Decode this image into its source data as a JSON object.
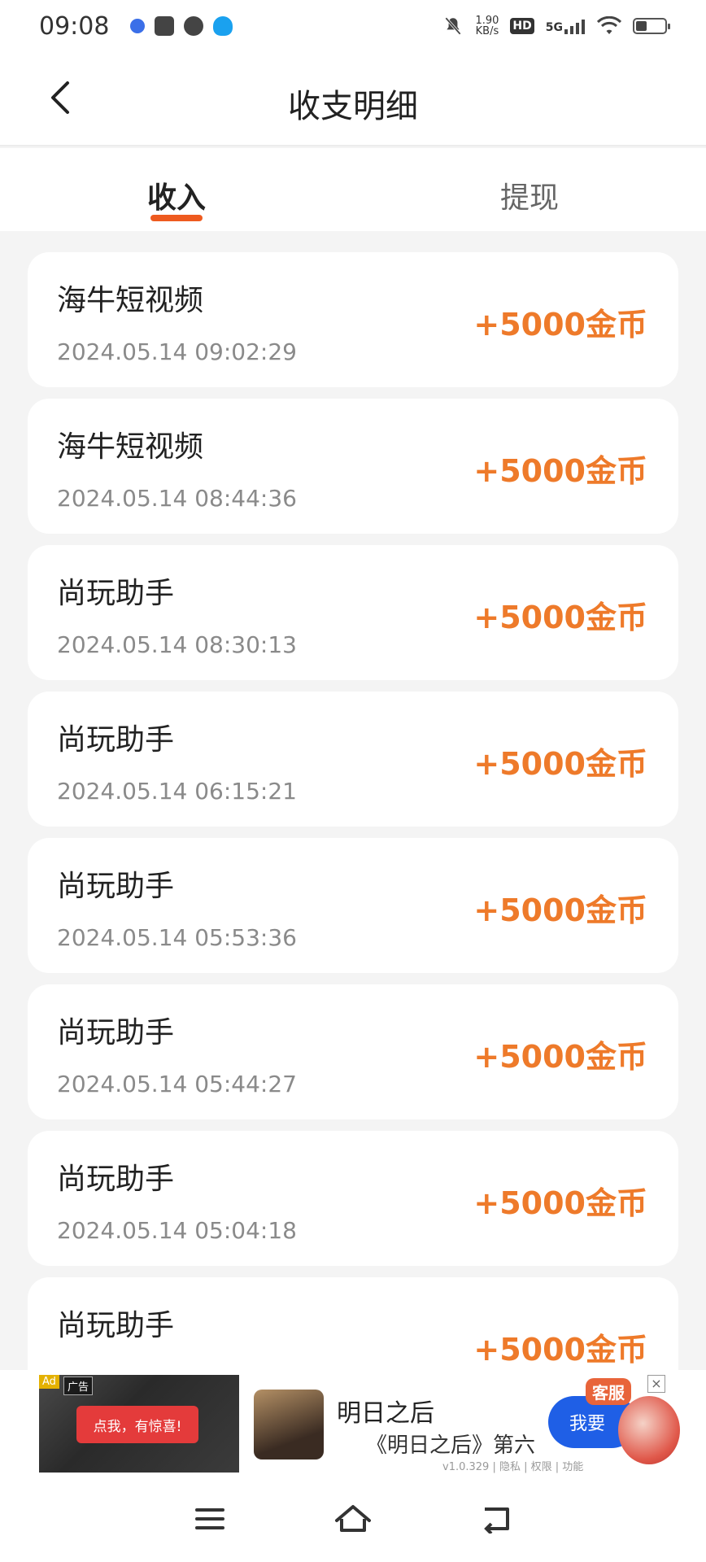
{
  "status_bar": {
    "time": "09:08",
    "net_speed_value": "1.90",
    "net_speed_unit": "KB/s",
    "hd": "HD",
    "network": "5G",
    "battery_level": 0.35
  },
  "header": {
    "title": "收支明细"
  },
  "tabs": [
    {
      "label": "收入",
      "active": true
    },
    {
      "label": "提现",
      "active": false
    }
  ],
  "records": [
    {
      "title": "海牛短视频",
      "time": "2024.05.14 09:02:29",
      "amount": "+5000金币"
    },
    {
      "title": "海牛短视频",
      "time": "2024.05.14 08:44:36",
      "amount": "+5000金币"
    },
    {
      "title": "尚玩助手",
      "time": "2024.05.14 08:30:13",
      "amount": "+5000金币"
    },
    {
      "title": "尚玩助手",
      "time": "2024.05.14 06:15:21",
      "amount": "+5000金币"
    },
    {
      "title": "尚玩助手",
      "time": "2024.05.14 05:53:36",
      "amount": "+5000金币"
    },
    {
      "title": "尚玩助手",
      "time": "2024.05.14 05:44:27",
      "amount": "+5000金币"
    },
    {
      "title": "尚玩助手",
      "time": "2024.05.14 05:04:18",
      "amount": "+5000金币"
    },
    {
      "title": "尚玩助手",
      "time": "",
      "amount": "+5000金币"
    }
  ],
  "ad": {
    "badge": "Ad",
    "label": "广告",
    "cta_text": "点我，有惊喜!",
    "title": "明日之后",
    "description": "《明日之后》第六",
    "meta": "v1.0.329 | 隐私 | 权限 | 功能",
    "button_label": "我要",
    "close_symbol": "×",
    "service_label": "客服"
  },
  "colors": {
    "accent": "#ee5a1f",
    "amount": "#ee7a2a",
    "background": "#f4f4f4"
  }
}
